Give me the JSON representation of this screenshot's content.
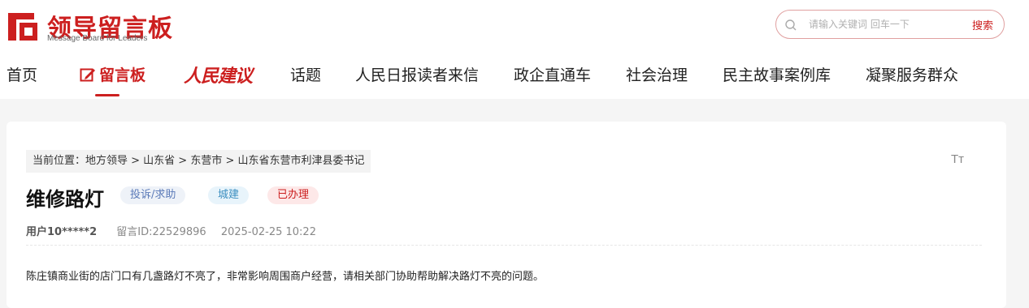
{
  "logo": {
    "title": "领导留言板",
    "subtitle": "Message Board for Leaders",
    "icon": "logo-mark"
  },
  "search": {
    "placeholder": "请输入关键词 回车一下",
    "button_label": "搜索",
    "icon": "search-icon"
  },
  "nav": {
    "items": [
      {
        "label": "首页"
      },
      {
        "label": "留言板",
        "active": true
      },
      {
        "label": "人民建议"
      },
      {
        "label": "话题"
      },
      {
        "label": "人民日报读者来信"
      },
      {
        "label": "政企直通车"
      },
      {
        "label": "社会治理"
      },
      {
        "label": "民主故事案例库"
      },
      {
        "label": "凝聚服务群众"
      }
    ]
  },
  "message": {
    "breadcrumb": "当前位置：地方领导 > 山东省 > 东营市 > 山东省东营市利津县委书记",
    "font_toggle": "Tт",
    "title": "维修路灯",
    "tags": {
      "type": "投诉/求助",
      "field": "城建",
      "status": "已办理"
    },
    "user": "用户10*****2",
    "message_id": "留言ID:22529896",
    "datetime": "2025-02-25 10:22",
    "content": "陈庄镇商业街的店门口有几盏路灯不亮了，非常影响周围商户经营，请相关部门协助帮助解决路灯不亮的问题。"
  },
  "colors": {
    "brand_red": "#cc1f1f",
    "page_bg": "#f5f5f5"
  }
}
